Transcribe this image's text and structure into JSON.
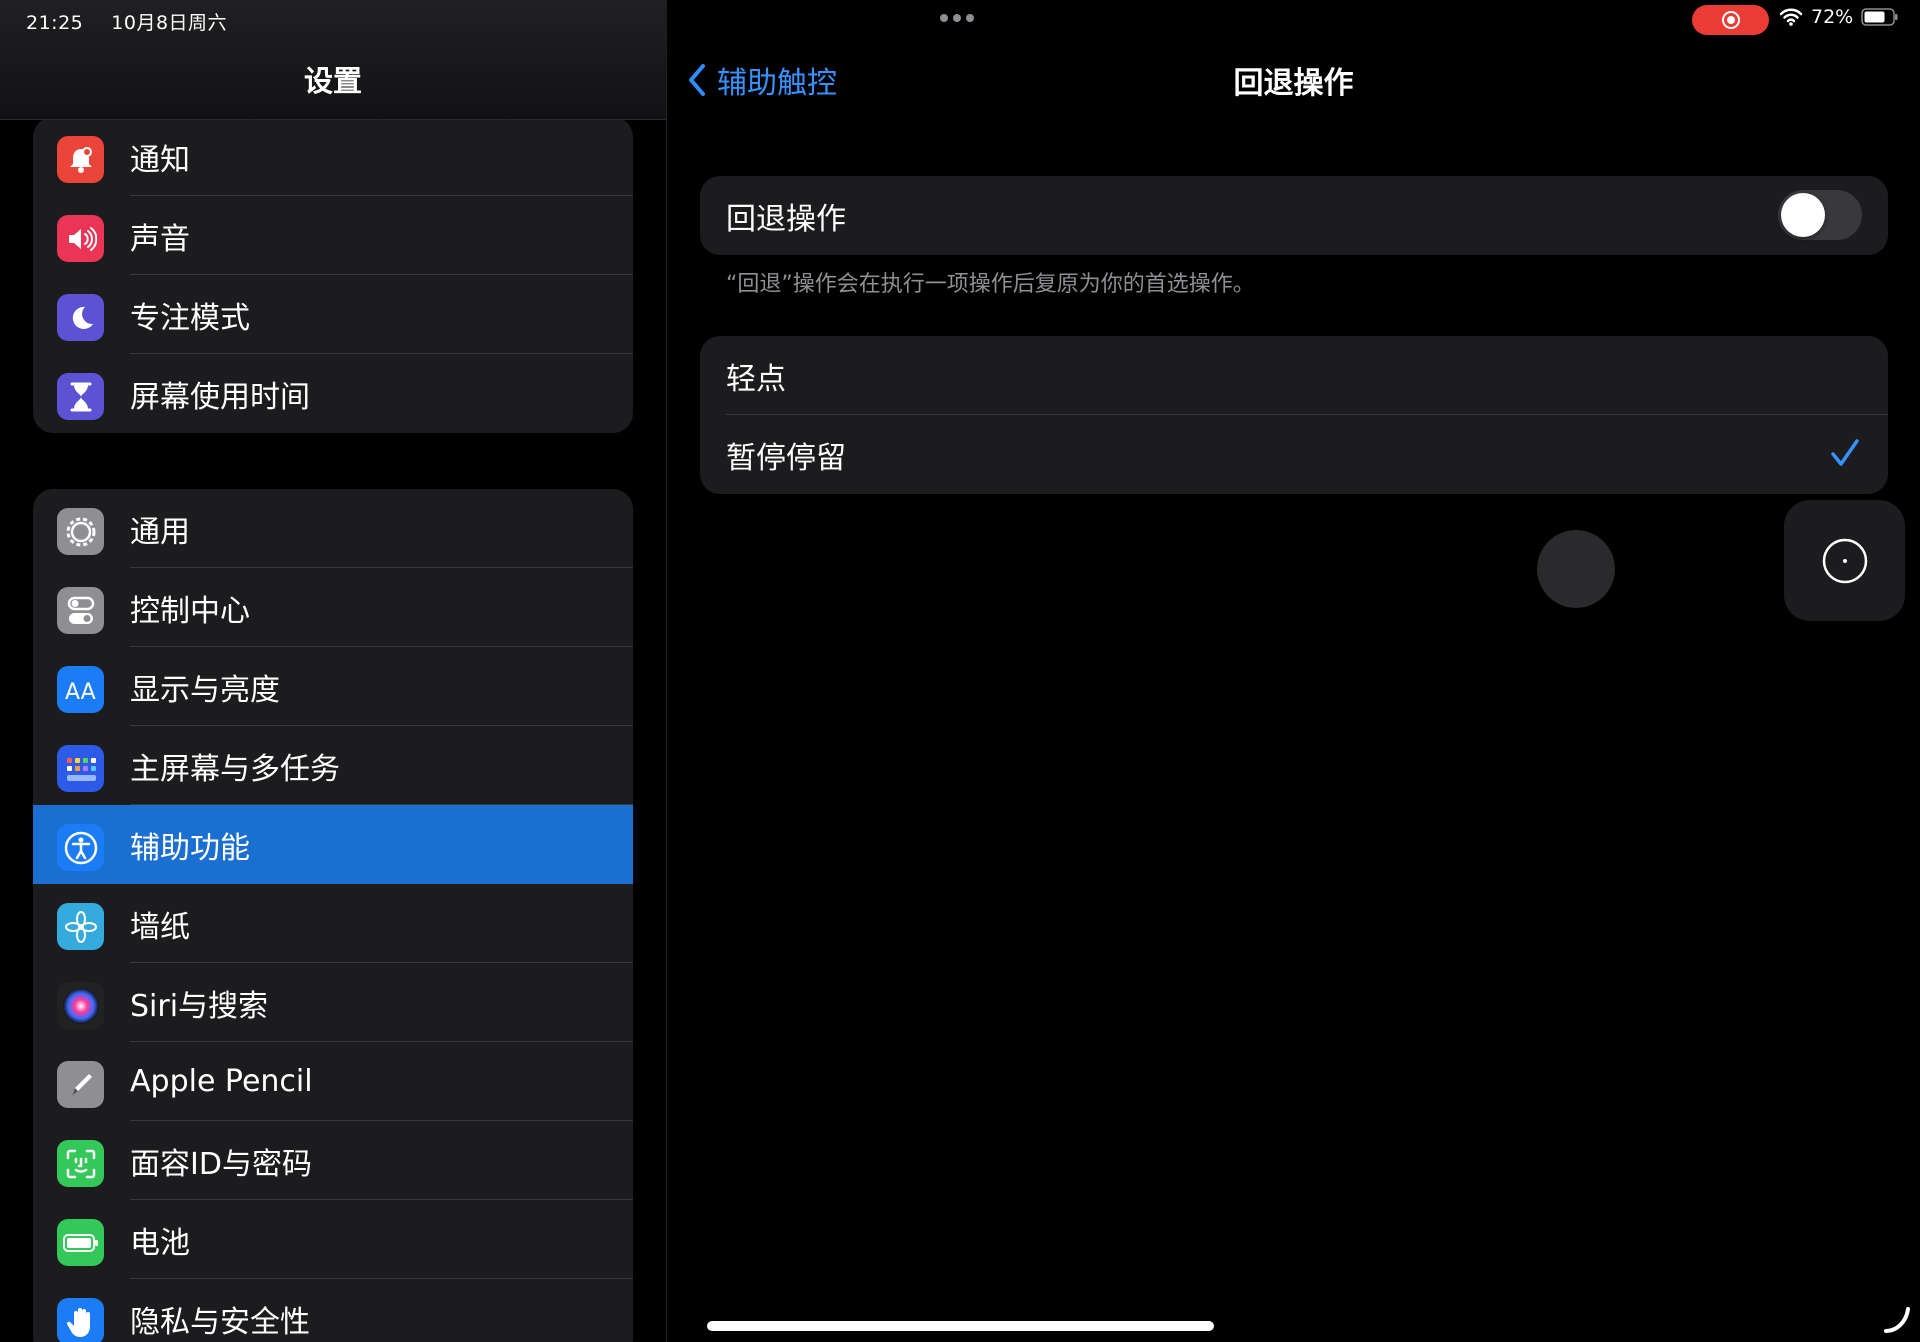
{
  "status_bar": {
    "time": "21:25",
    "date": "10月8日周六",
    "battery": "72%"
  },
  "sidebar": {
    "title": "设置",
    "groups": [
      {
        "items": [
          {
            "label": "通知",
            "icon": "notification-bell-icon",
            "color": "#eb4438"
          },
          {
            "label": "声音",
            "icon": "speaker-icon",
            "color": "#eb3557"
          },
          {
            "label": "专注模式",
            "icon": "moon-icon",
            "color": "#5b53d4"
          },
          {
            "label": "屏幕使用时间",
            "icon": "hourglass-icon",
            "color": "#5b53d4"
          }
        ]
      },
      {
        "items": [
          {
            "label": "通用",
            "icon": "gear-icon",
            "color": "#8e8e93"
          },
          {
            "label": "控制中心",
            "icon": "toggles-icon",
            "color": "#8e8e93"
          },
          {
            "label": "显示与亮度",
            "icon": "aa-text-icon",
            "color": "#1b7cf5"
          },
          {
            "label": "主屏幕与多任务",
            "icon": "app-grid-icon",
            "color": "#2d5ae6"
          },
          {
            "label": "辅助功能",
            "icon": "accessibility-icon",
            "color": "#1b7cf5",
            "selected": true
          },
          {
            "label": "墙纸",
            "icon": "flower-icon",
            "color": "#35aadc"
          },
          {
            "label": "Siri与搜索",
            "icon": "siri-icon",
            "color": "#222222"
          },
          {
            "label": "Apple Pencil",
            "icon": "pencil-icon",
            "color": "#8e8e93"
          },
          {
            "label": "面容ID与密码",
            "icon": "face-id-icon",
            "color": "#34c759"
          },
          {
            "label": "电池",
            "icon": "battery-icon",
            "color": "#34c759"
          },
          {
            "label": "隐私与安全性",
            "icon": "hand-icon",
            "color": "#1b7cf5"
          }
        ]
      }
    ]
  },
  "detail": {
    "back_label": "辅助触控",
    "title": "回退操作",
    "toggle_row": {
      "label": "回退操作",
      "on": false
    },
    "footnote": "“回退”操作会在执行一项操作后复原为你的首选操作。",
    "options": [
      {
        "label": "轻点",
        "checked": false
      },
      {
        "label": "暂停停留",
        "checked": true
      }
    ]
  },
  "colors": {
    "accent": "#3592ff",
    "selected_row": "#1a6fd0",
    "record_pill": "#eb3b35"
  }
}
